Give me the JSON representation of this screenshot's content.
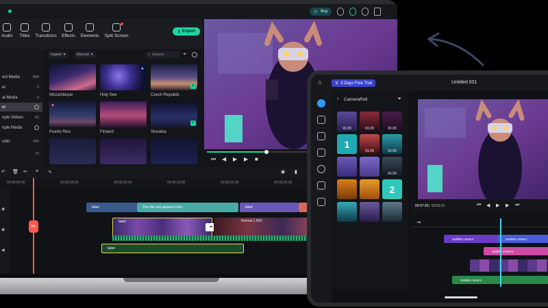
{
  "laptop": {
    "topbar": {
      "buy": "Buy"
    },
    "toolbar": {
      "tools": [
        "Audio",
        "Titles",
        "Transitions",
        "Effects",
        "Elements",
        "Split Screen"
      ],
      "export": "Export"
    },
    "sidebar": [
      {
        "label": "ect Media",
        "count": "889"
      },
      {
        "label": "er",
        "count": "0"
      },
      {
        "label": "al Media",
        "count": "4"
      },
      {
        "label": "er",
        "count": ""
      },
      {
        "label": "nple Videos",
        "count": "60"
      },
      {
        "label": "nple Media",
        "count": ""
      },
      {
        "label": "udio",
        "count": "490"
      },
      {
        "label": "",
        "count": "70"
      }
    ],
    "media_bar": {
      "import": "Import",
      "record": "Record",
      "search_placeholder": "Search"
    },
    "media_items": [
      "Mozambique",
      "Holy See",
      "Czech Republic",
      "Puerto Rico",
      "Finland",
      "Slovakia"
    ],
    "ruler": [
      "00:00:00:00",
      "00:00:05:00",
      "00:00:10:00",
      "00:00:15:00",
      "00:00:20:00",
      "00:00:25:00"
    ],
    "clips": {
      "label1": "label",
      "title_text": "The title text appears here",
      "label2": "label",
      "video_label": "label",
      "normal": "Normal 1.00X",
      "audio_label": "label"
    }
  },
  "tablet": {
    "badge": "3 Days Free Trial",
    "title": "Untitled 001",
    "panel_title": "CameraRoll",
    "durations": [
      "01:20",
      "01:20",
      "01:20",
      "01:20",
      "01:20",
      "01:20",
      "01:20"
    ],
    "numbers": [
      "1",
      "2"
    ],
    "timecode_current": "00:07:20",
    "timecode_total": "00:53:21",
    "clips": {
      "subtitle1": "Subtitle content",
      "subtitle2": "Subtitle content",
      "subtitle3": "Subtitle content",
      "subtitle4": "Subtitle content"
    }
  },
  "colors": {
    "accent": "#1ed4a0",
    "playhead": "#ff5a4d",
    "tablet_playhead": "#41d8ef"
  }
}
